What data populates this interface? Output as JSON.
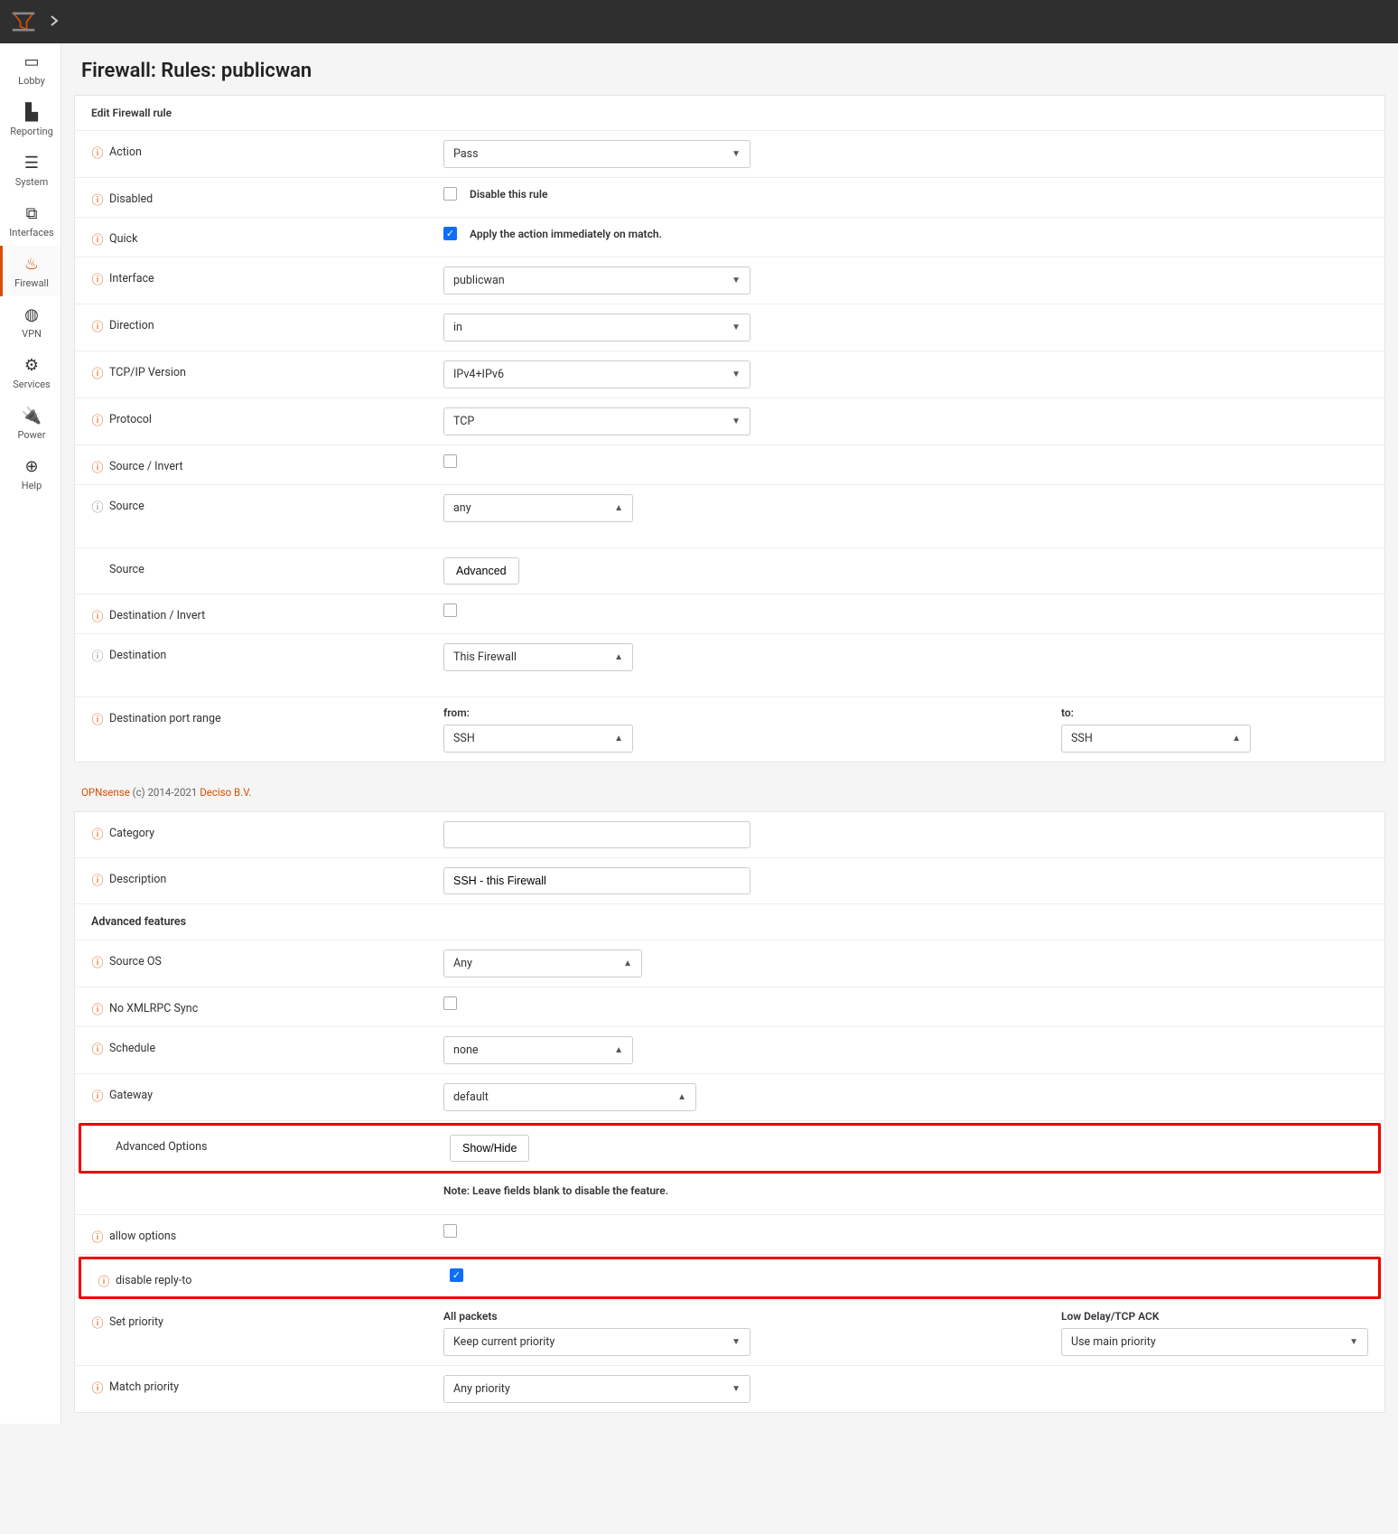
{
  "sidebar": {
    "items": [
      {
        "label": "Lobby"
      },
      {
        "label": "Reporting"
      },
      {
        "label": "System"
      },
      {
        "label": "Interfaces"
      },
      {
        "label": "Firewall"
      },
      {
        "label": "VPN"
      },
      {
        "label": "Services"
      },
      {
        "label": "Power"
      },
      {
        "label": "Help"
      }
    ]
  },
  "page": {
    "title": "Firewall: Rules: publicwan",
    "panel_header": "Edit Firewall rule"
  },
  "fields": {
    "action": {
      "label": "Action",
      "value": "Pass"
    },
    "disabled": {
      "label": "Disabled",
      "chk_label": "Disable this rule"
    },
    "quick": {
      "label": "Quick",
      "chk_label": "Apply the action immediately on match."
    },
    "interface": {
      "label": "Interface",
      "value": "publicwan"
    },
    "direction": {
      "label": "Direction",
      "value": "in"
    },
    "tcpip": {
      "label": "TCP/IP Version",
      "value": "IPv4+IPv6"
    },
    "protocol": {
      "label": "Protocol",
      "value": "TCP"
    },
    "src_invert": {
      "label": "Source / Invert"
    },
    "source": {
      "label": "Source",
      "value": "any"
    },
    "source2": {
      "label": "Source",
      "btn": "Advanced"
    },
    "dst_invert": {
      "label": "Destination / Invert"
    },
    "destination": {
      "label": "Destination",
      "value": "This Firewall"
    },
    "dst_port": {
      "label": "Destination port range",
      "from_label": "from:",
      "to_label": "to:",
      "from": "SSH",
      "to": "SSH"
    },
    "category": {
      "label": "Category"
    },
    "description": {
      "label": "Description",
      "value": "SSH - this Firewall"
    },
    "adv_header": "Advanced features",
    "source_os": {
      "label": "Source OS",
      "value": "Any"
    },
    "no_xmlrpc": {
      "label": "No XMLRPC Sync"
    },
    "schedule": {
      "label": "Schedule",
      "value": "none"
    },
    "gateway": {
      "label": "Gateway",
      "value": "default"
    },
    "adv_options": {
      "label": "Advanced Options",
      "btn": "Show/Hide"
    },
    "adv_note": "Note: Leave fields blank to disable the feature.",
    "allow_options": {
      "label": "allow options"
    },
    "disable_replyto": {
      "label": "disable reply-to"
    },
    "set_priority": {
      "label": "Set priority",
      "all_label": "All packets",
      "ack_label": "Low Delay/TCP ACK",
      "all_value": "Keep current priority",
      "ack_value": "Use main priority"
    },
    "match_priority": {
      "label": "Match priority",
      "value": "Any priority"
    }
  },
  "footer": {
    "brand": "OPNsense",
    "mid": " (c) 2014-2021 ",
    "company": "Deciso B.V."
  }
}
